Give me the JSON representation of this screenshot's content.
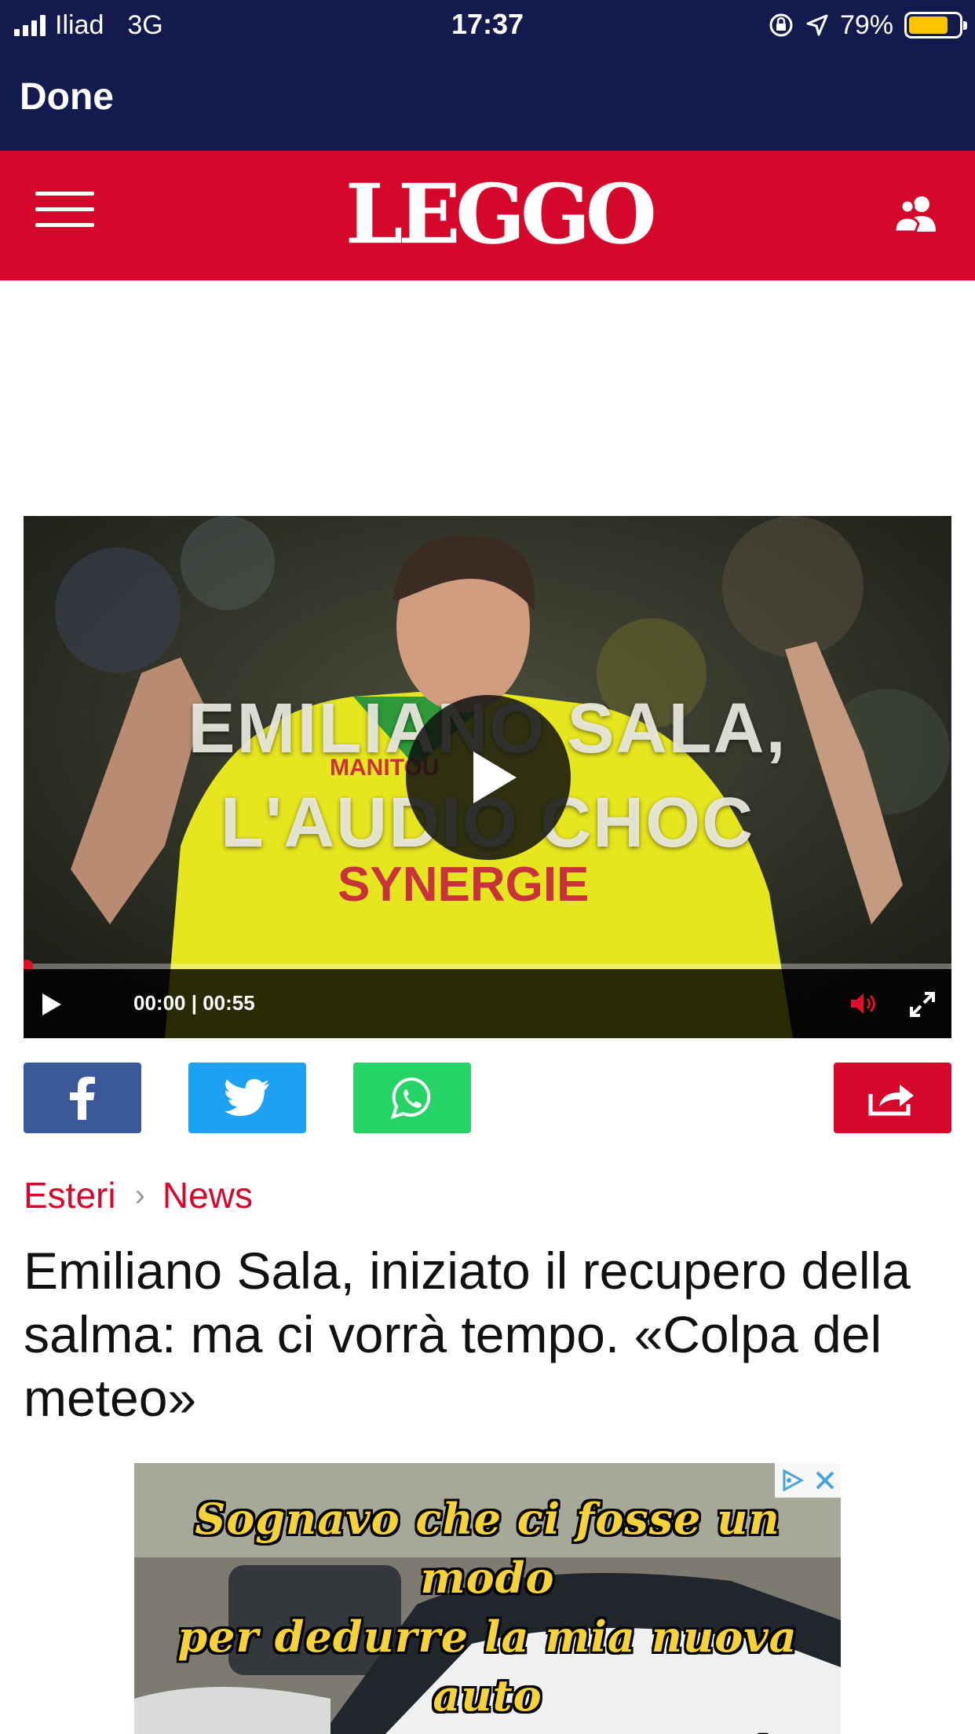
{
  "status_bar": {
    "carrier": "Iliad",
    "network": "3G",
    "time": "17:37",
    "battery": "79%",
    "battery_level": 0.79
  },
  "nav": {
    "done_label": "Done"
  },
  "header": {
    "logo_text": "LEGGO",
    "brand_color": "#d5072b"
  },
  "video": {
    "overlay_line1": "EMILIANO SALA,",
    "overlay_line2": "L'AUDIO CHOC",
    "jersey_text1": "MANITOU",
    "jersey_text2": "SYNERGIE",
    "time_display": "00:00 | 00:55",
    "progress": 0
  },
  "share": {
    "facebook_color": "#3b5998",
    "twitter_color": "#1da1f2",
    "whatsapp_color": "#25d366",
    "share_color": "#d5072b"
  },
  "breadcrumb": {
    "section": "Esteri",
    "subsection": "News"
  },
  "article": {
    "headline": "Emiliano Sala, iniziato il recupero della salma: ma ci vorrà tempo. «Colpa del meteo»"
  },
  "ad": {
    "line1": "Sognavo che ci fosse un modo",
    "line2": "per dedurre la mia nuova auto",
    "line3": "aziendale. Infatti c'è..."
  }
}
